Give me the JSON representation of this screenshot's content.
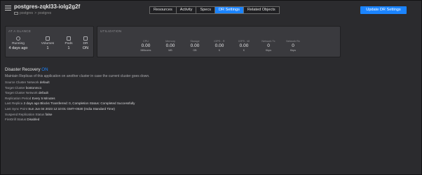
{
  "header": {
    "title": "postgres-zqkl33-iolg2g2f",
    "breadcrumb": {
      "project": "postgres",
      "separator": ">",
      "resource": "postgres"
    }
  },
  "tabs": [
    {
      "label": "Resources",
      "active": false
    },
    {
      "label": "Activity",
      "active": false
    },
    {
      "label": "Specs",
      "active": false
    },
    {
      "label": "DR Settings",
      "active": true
    },
    {
      "label": "Related Objects",
      "active": false
    }
  ],
  "update_button": "Update DR Settings",
  "glance": {
    "title": "AT A GLANCE",
    "items": [
      {
        "label": "Running",
        "value": "4 days ago",
        "icon": "status-icon"
      },
      {
        "label": "Volumes",
        "value": "1",
        "icon": "volume-icon"
      },
      {
        "label": "Pods",
        "value": "1",
        "icon": "pod-icon"
      },
      {
        "label": "DR",
        "value": "ON",
        "icon": "dr-icon"
      }
    ]
  },
  "utilization": {
    "title": "UTILIZATION",
    "metrics": [
      {
        "label": "CPU",
        "value": "0.00",
        "unit": "Millicores"
      },
      {
        "label": "Memory",
        "value": "0.00",
        "unit": "MB"
      },
      {
        "label": "Storage",
        "value": "0.00",
        "unit": "GB"
      },
      {
        "label": "IOPS - R",
        "value": "0.00",
        "unit": "K"
      },
      {
        "label": "IOPS - W",
        "value": "0.00",
        "unit": "K"
      },
      {
        "label": "Network Tx",
        "value": "0",
        "unit": "Kbps"
      },
      {
        "label": "Network Rx",
        "value": "0",
        "unit": "Kbps"
      }
    ]
  },
  "disaster_recovery": {
    "heading": "Disaster Recovery",
    "status": "ON",
    "description": "Maintain Replicas of this application on another cluster in case the current cluster goes down.",
    "rows": [
      {
        "label": "Source Cluster Network",
        "value": "default"
      },
      {
        "label": "Target Cluster",
        "value": "bostonmc1"
      },
      {
        "label": "Target Cluster Network",
        "value": "default"
      },
      {
        "label": "Replication Period",
        "value": "Every 5 Minutes"
      },
      {
        "label": "Last Replica",
        "value": "2 days ago   Blocks Transferred: 0, Completion Status: Completed Successfully"
      },
      {
        "label": "Last Sync Point",
        "value": "Sun Jun 04 2023 12:10:01 GMT+0530 (India Standard Time)"
      },
      {
        "label": "Suspend Replication Status",
        "value": "false"
      },
      {
        "label": "FireDrill Status",
        "value": "Disabled"
      }
    ]
  },
  "colors": {
    "accent": "#1b84ff",
    "background": "#2b2b2e",
    "panel": "#3a3a3e"
  }
}
